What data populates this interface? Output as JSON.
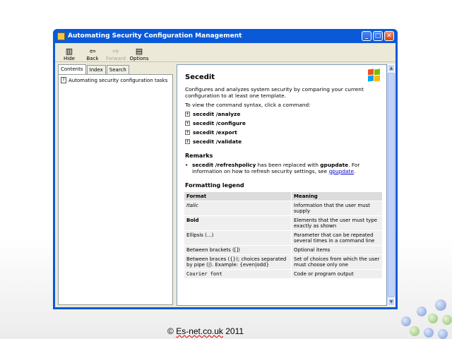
{
  "window": {
    "title": "Automating Security Configuration Management",
    "controls": {
      "minimize": "_",
      "maximize": "□",
      "close": "✕"
    }
  },
  "toolbar": {
    "hide": "Hide",
    "back": "Back",
    "forward": "Forward",
    "options": "Options"
  },
  "nav": {
    "tabs": [
      "Contents",
      "Index",
      "Search"
    ],
    "topics": [
      "Automating security configuration tasks"
    ]
  },
  "doc": {
    "title": "Secedit",
    "intro": "Configures and analyzes system security by comparing your current configuration to at least one template.",
    "syntax_intro": "To view the command syntax, click a command:",
    "commands": [
      "secedit /analyze",
      "secedit /configure",
      "secedit /export",
      "secedit /validate"
    ],
    "remarks_heading": "Remarks",
    "remark_cmd": "secedit /refreshpolicy",
    "remark_mid": " has been replaced with ",
    "remark_gpupdate": "gpupdate",
    "remark_tail": ". For information on how to refresh security settings, see ",
    "remark_link": "gpupdate",
    "remark_end": ".",
    "legend_heading": "Formatting legend",
    "legend_headers": [
      "Format",
      "Meaning"
    ],
    "legend_rows": [
      {
        "format": "Italic",
        "meaning": "Information that the user must supply"
      },
      {
        "format": "Bold",
        "meaning": "Elements that the user must type exactly as shown"
      },
      {
        "format": "Ellipsis (...)",
        "meaning": "Parameter that can be repeated several times in a command line"
      },
      {
        "format": "Between brackets ([])",
        "meaning": "Optional items"
      },
      {
        "format": "Between braces ({}); choices separated by pipe (|). Example: {even|odd}",
        "meaning": "Set of choices from which the user must choose only one"
      },
      {
        "format": "Courier font",
        "meaning": "Code or program output"
      }
    ]
  },
  "footer": {
    "prefix": "© ",
    "site": "Es-net.co.uk",
    "year": " 2011"
  },
  "colors": {
    "titlebar": "#0a5ad8",
    "client": "#ece9d8",
    "link": "#0000cc"
  }
}
